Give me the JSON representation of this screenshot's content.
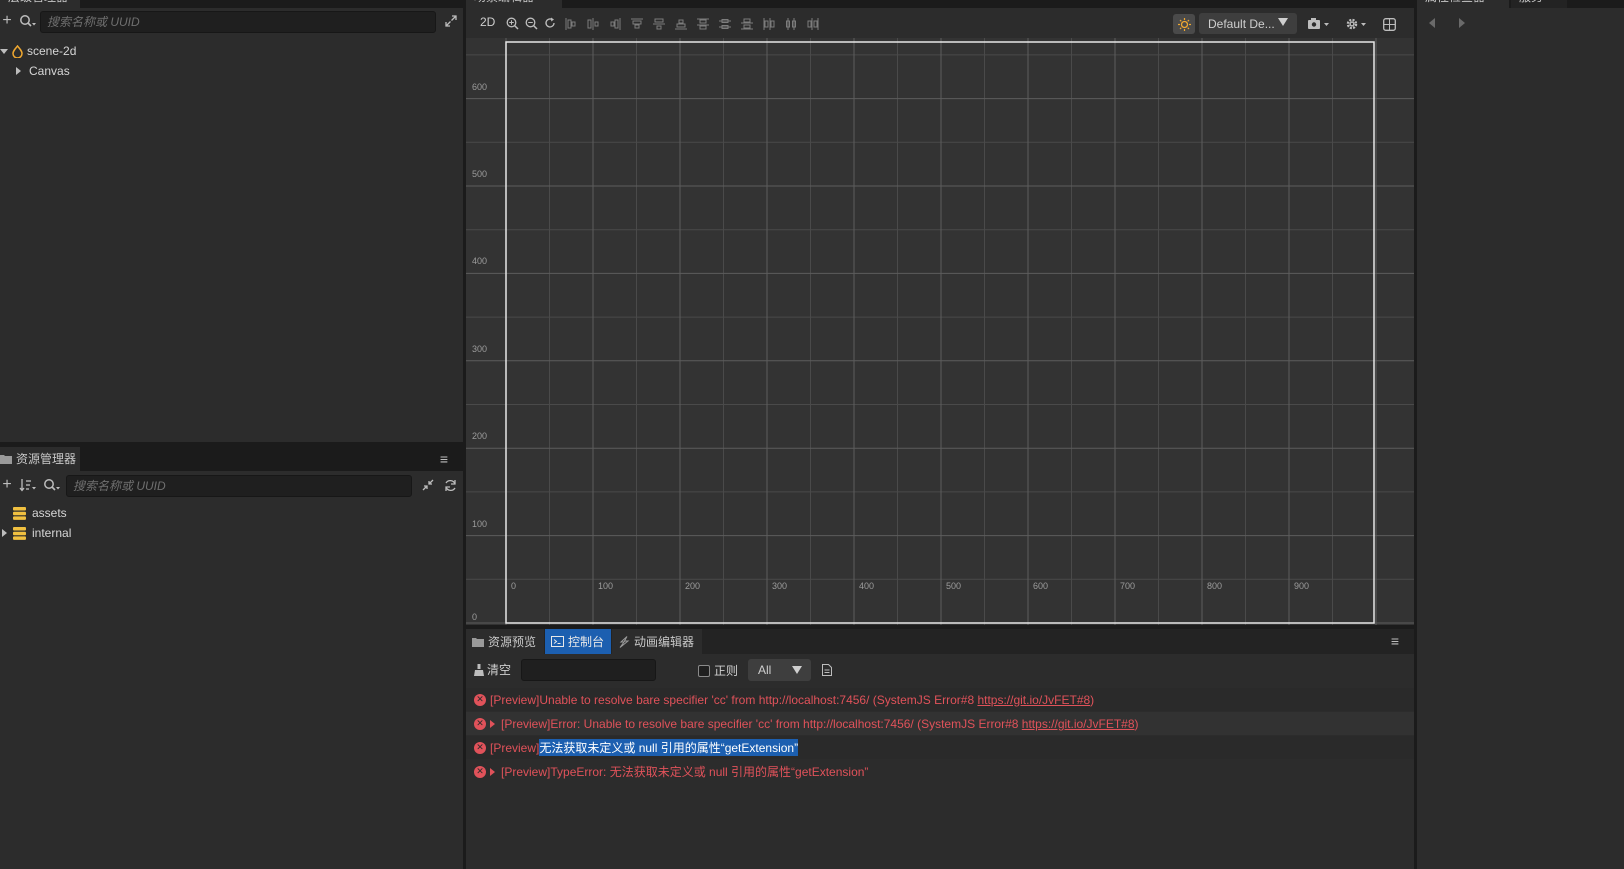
{
  "hierarchy": {
    "tab_label": "层级管理器",
    "search_placeholder": "搜索名称或 UUID",
    "items": [
      {
        "label": "scene-2d"
      },
      {
        "label": "Canvas"
      }
    ]
  },
  "assets": {
    "tab_label": "资源管理器",
    "search_placeholder": "搜索名称或 UUID",
    "items": [
      {
        "label": "assets"
      },
      {
        "label": "internal"
      }
    ]
  },
  "scene": {
    "tab_label": "场景编辑器",
    "mode_label": "2D",
    "layout_select": "Default De...",
    "y_ticks": [
      "600",
      "500",
      "400",
      "300",
      "200",
      "100",
      "0"
    ],
    "x_ticks": [
      "0",
      "100",
      "200",
      "300",
      "400",
      "500",
      "600",
      "700",
      "800",
      "900"
    ]
  },
  "inspector": {
    "tab_label": "属性检查器",
    "tab2_label": "服务"
  },
  "console": {
    "tabs": [
      {
        "label": "资源预览"
      },
      {
        "label": "控制台"
      },
      {
        "label": "动画编辑器"
      }
    ],
    "clear_label": "清空",
    "regex_label": "正则",
    "level_select": "All",
    "logs": [
      {
        "prefix": "[Preview]Unable to resolve bare specifier 'cc' from http://localhost:7456/ (SystemJS Error#8 ",
        "link": "https://git.io/JvFET#8",
        "suffix": ")"
      },
      {
        "prefix": "[Preview]Error: Unable to resolve bare specifier 'cc' from http://localhost:7456/ (SystemJS Error#8 ",
        "link": "https://git.io/JvFET#8",
        "suffix": ")"
      },
      {
        "prefix": "[Preview]",
        "selected": "无法获取未定义或 null 引用的属性“getExtension”"
      },
      {
        "prefix": "[Preview]TypeError: 无法获取未定义或 null 引用的属性“getExtension”"
      }
    ]
  },
  "colors": {
    "accent": "#1c5fb0",
    "error": "#e0525a",
    "warning_icon": "#f0a830"
  }
}
